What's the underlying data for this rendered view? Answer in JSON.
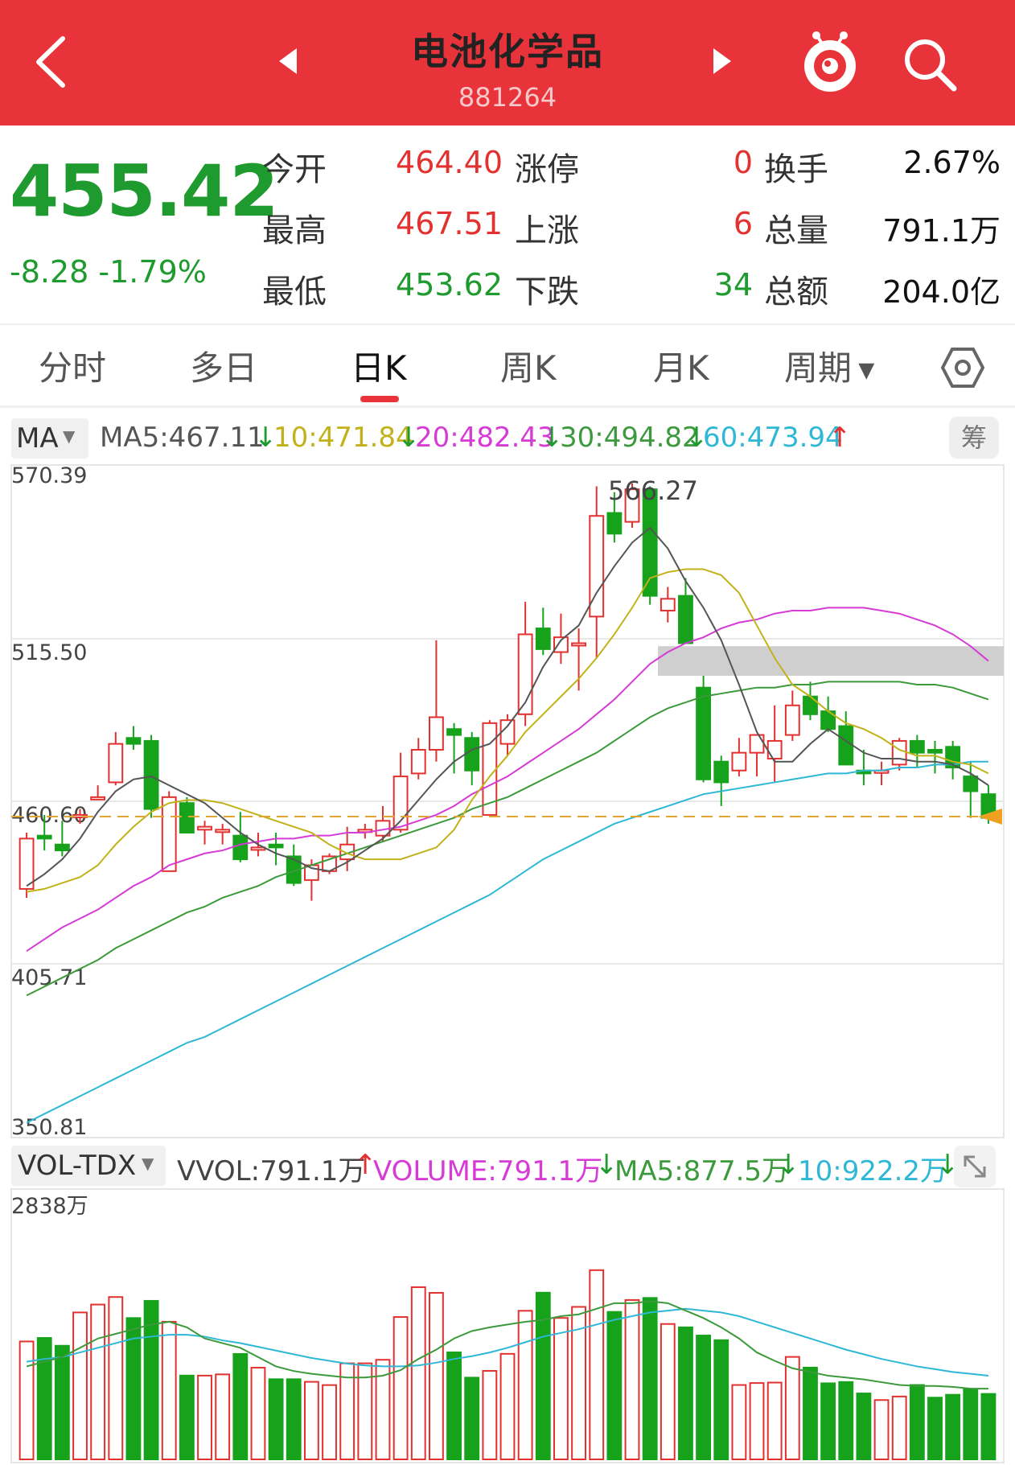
{
  "header": {
    "title": "电池化学品",
    "code": "881264"
  },
  "quote": {
    "price": "455.42",
    "change": "-8.28",
    "change_pct": "-1.79%",
    "open_label": "今开",
    "open": "464.40",
    "high_label": "最高",
    "high": "467.51",
    "low_label": "最低",
    "low": "453.62",
    "limit_up_label": "涨停",
    "limit_up": "0",
    "rise_label": "上涨",
    "rise": "6",
    "fall_label": "下跌",
    "fall": "34",
    "turnover_label": "换手",
    "turnover": "2.67%",
    "volume_label": "总量",
    "volume": "791.1万",
    "amount_label": "总额",
    "amount": "204.0亿"
  },
  "tabs": [
    "分时",
    "多日",
    "日K",
    "周K",
    "月K",
    "周期"
  ],
  "selected_tab": "日K",
  "ma_legend": {
    "selector": "MA",
    "ma5": "MA5:467.11",
    "ma10": "10:471.84",
    "ma20": "20:482.43",
    "ma30": "30:494.82",
    "ma60": "60:473.94",
    "chip_label": "筹"
  },
  "vol_legend": {
    "selector": "VOL-TDX",
    "vvol": "VVOL:791.1万",
    "volume": "VOLUME:791.1万",
    "ma5": "MA5:877.5万",
    "ma10": "10:922.2万"
  },
  "colors": {
    "up": "#e2312f",
    "down": "#16a21b",
    "ma5": "#555555",
    "ma10": "#c2b21a",
    "ma20": "#d63bd6",
    "ma30": "#3c9a3c",
    "ma60": "#2eb8d6"
  },
  "chart_data": [
    {
      "type": "candlestick",
      "y_ticks": [
        "570.39",
        "515.50",
        "460.60",
        "405.71",
        "350.81"
      ],
      "ylim": [
        350.81,
        570.39
      ],
      "high_marker": "566.27",
      "current_price_line": 455.42,
      "candles": [
        {
          "o": 431,
          "h": 450,
          "l": 428,
          "c": 448
        },
        {
          "o": 449,
          "h": 456,
          "l": 444,
          "c": 448
        },
        {
          "o": 446,
          "h": 454,
          "l": 442,
          "c": 444
        },
        {
          "o": 456,
          "h": 458,
          "l": 453,
          "c": 456
        },
        {
          "o": 462,
          "h": 466,
          "l": 461,
          "c": 462
        },
        {
          "o": 467,
          "h": 484,
          "l": 466,
          "c": 480
        },
        {
          "o": 482,
          "h": 486,
          "l": 478,
          "c": 480
        },
        {
          "o": 481,
          "h": 483,
          "l": 455,
          "c": 458
        },
        {
          "o": 437,
          "h": 464,
          "l": 437,
          "c": 462
        },
        {
          "o": 460,
          "h": 462,
          "l": 450,
          "c": 450
        },
        {
          "o": 451,
          "h": 454,
          "l": 446,
          "c": 452
        },
        {
          "o": 451,
          "h": 453,
          "l": 446,
          "c": 451
        },
        {
          "o": 449,
          "h": 457,
          "l": 440,
          "c": 441
        },
        {
          "o": 445,
          "h": 450,
          "l": 442,
          "c": 445
        },
        {
          "o": 446,
          "h": 450,
          "l": 439,
          "c": 445
        },
        {
          "o": 442,
          "h": 446,
          "l": 432,
          "c": 433
        },
        {
          "o": 434,
          "h": 441,
          "l": 427,
          "c": 439
        },
        {
          "o": 437,
          "h": 443,
          "l": 436,
          "c": 442
        },
        {
          "o": 441,
          "h": 452,
          "l": 437,
          "c": 446
        },
        {
          "o": 451,
          "h": 453,
          "l": 448,
          "c": 451
        },
        {
          "o": 449,
          "h": 459,
          "l": 447,
          "c": 454
        },
        {
          "o": 451,
          "h": 477,
          "l": 450,
          "c": 469
        },
        {
          "o": 470,
          "h": 482,
          "l": 468,
          "c": 478
        },
        {
          "o": 478,
          "h": 515,
          "l": 474,
          "c": 489
        },
        {
          "o": 485,
          "h": 487,
          "l": 470,
          "c": 483
        },
        {
          "o": 482,
          "h": 484,
          "l": 466,
          "c": 471
        },
        {
          "o": 456,
          "h": 488,
          "l": 456,
          "c": 487
        },
        {
          "o": 480,
          "h": 490,
          "l": 476,
          "c": 488
        },
        {
          "o": 490,
          "h": 528,
          "l": 486,
          "c": 517
        },
        {
          "o": 519,
          "h": 526,
          "l": 510,
          "c": 512
        },
        {
          "o": 511,
          "h": 524,
          "l": 507,
          "c": 516
        },
        {
          "o": 514,
          "h": 519,
          "l": 498,
          "c": 514
        },
        {
          "o": 523,
          "h": 567,
          "l": 509,
          "c": 557
        },
        {
          "o": 558,
          "h": 565,
          "l": 548,
          "c": 551
        },
        {
          "o": 555,
          "h": 568,
          "l": 553,
          "c": 566
        },
        {
          "o": 566,
          "h": 567,
          "l": 527,
          "c": 530
        },
        {
          "o": 525,
          "h": 533,
          "l": 521,
          "c": 529
        },
        {
          "o": 530,
          "h": 536,
          "l": 514,
          "c": 514
        },
        {
          "o": 499,
          "h": 503,
          "l": 467,
          "c": 468
        },
        {
          "o": 474,
          "h": 476,
          "l": 459,
          "c": 467
        },
        {
          "o": 471,
          "h": 482,
          "l": 469,
          "c": 477
        },
        {
          "o": 477,
          "h": 482,
          "l": 469,
          "c": 483
        },
        {
          "o": 475,
          "h": 493,
          "l": 467,
          "c": 481
        },
        {
          "o": 483,
          "h": 498,
          "l": 481,
          "c": 493
        },
        {
          "o": 496,
          "h": 501,
          "l": 488,
          "c": 490
        },
        {
          "o": 491,
          "h": 496,
          "l": 484,
          "c": 485
        },
        {
          "o": 486,
          "h": 491,
          "l": 483,
          "c": 473
        },
        {
          "o": 471,
          "h": 478,
          "l": 466,
          "c": 470
        },
        {
          "o": 471,
          "h": 474,
          "l": 466,
          "c": 471
        },
        {
          "o": 473,
          "h": 482,
          "l": 471,
          "c": 481
        },
        {
          "o": 481,
          "h": 483,
          "l": 472,
          "c": 477
        },
        {
          "o": 478,
          "h": 481,
          "l": 470,
          "c": 477
        },
        {
          "o": 479,
          "h": 481,
          "l": 468,
          "c": 472
        },
        {
          "o": 469,
          "h": 474,
          "l": 455,
          "c": 464
        },
        {
          "o": 463,
          "h": 466,
          "l": 453,
          "c": 455
        }
      ],
      "ma5": [
        432,
        436,
        441,
        448,
        457,
        464,
        468,
        469,
        466,
        463,
        460,
        455,
        450,
        446,
        443,
        441,
        438,
        437,
        440,
        444,
        448,
        454,
        461,
        468,
        474,
        478,
        480,
        486,
        494,
        506,
        515,
        520,
        531,
        540,
        548,
        553,
        546,
        535,
        526,
        515,
        500,
        484,
        474,
        474,
        480,
        485,
        481,
        477,
        475,
        475,
        474,
        474,
        473,
        470,
        466
      ],
      "ma10": [
        430,
        431,
        433,
        435,
        439,
        446,
        452,
        457,
        460,
        461,
        461,
        460,
        458,
        456,
        454,
        452,
        450,
        446,
        443,
        441,
        441,
        441,
        443,
        445,
        451,
        461,
        469,
        476,
        484,
        490,
        496,
        502,
        509,
        517,
        526,
        536,
        538,
        539,
        539,
        537,
        531,
        520,
        509,
        500,
        496,
        491,
        487,
        485,
        482,
        478,
        476,
        476,
        474,
        473,
        470
      ],
      "ma20": [
        410,
        414,
        418,
        421,
        424,
        428,
        432,
        435,
        439,
        441,
        443,
        444,
        446,
        447,
        448,
        448,
        449,
        449,
        450,
        450,
        451,
        452,
        454,
        456,
        459,
        463,
        466,
        469,
        473,
        477,
        481,
        485,
        490,
        495,
        501,
        507,
        511,
        514,
        516,
        519,
        521,
        522,
        524,
        525,
        525,
        526,
        526,
        526,
        525,
        524,
        522,
        520,
        517,
        513,
        508
      ],
      "ma30": [
        395,
        398,
        401,
        404,
        407,
        411,
        414,
        417,
        420,
        423,
        425,
        428,
        430,
        432,
        435,
        437,
        439,
        441,
        443,
        445,
        447,
        449,
        451,
        453,
        455,
        458,
        460,
        462,
        465,
        468,
        471,
        474,
        477,
        481,
        485,
        489,
        492,
        494,
        496,
        497,
        498,
        499,
        499,
        500,
        500,
        501,
        501,
        501,
        501,
        501,
        500,
        500,
        499,
        497,
        495
      ],
      "ma60": [
        352,
        355,
        358,
        361,
        364,
        367,
        370,
        373,
        376,
        379,
        381,
        384,
        387,
        390,
        393,
        396,
        399,
        402,
        405,
        408,
        411,
        414,
        417,
        420,
        423,
        426,
        429,
        433,
        437,
        441,
        444,
        447,
        450,
        453,
        455,
        457,
        459,
        461,
        463,
        464,
        465,
        466,
        467,
        468,
        469,
        470,
        470,
        471,
        471,
        472,
        472,
        473,
        473,
        474,
        474
      ]
    },
    {
      "type": "bar",
      "series_name": "VOLUME",
      "y_ticks": [
        "2838万"
      ],
      "ylim": [
        0,
        2838
      ],
      "volumes": [
        1268,
        1306,
        1222,
        1580,
        1665,
        1746,
        1520,
        1705,
        1480,
        901,
        901,
        914,
        1134,
        986,
        862,
        862,
        834,
        799,
        1033,
        1033,
        1071,
        1531,
        1852,
        1791,
        1151,
        879,
        952,
        1135,
        1598,
        1793,
        1521,
        1640,
        2035,
        1586,
        1714,
        1736,
        1456,
        1420,
        1332,
        1282,
        800,
        821,
        826,
        1102,
        987,
        818,
        832,
        709,
        638,
        676,
        800,
        664,
        695,
        758,
        704
      ],
      "vol_ma5": [
        1000,
        1050,
        1100,
        1200,
        1300,
        1350,
        1400,
        1450,
        1480,
        1420,
        1300,
        1250,
        1200,
        1100,
        1000,
        950,
        920,
        900,
        880,
        880,
        900,
        960,
        1080,
        1180,
        1300,
        1380,
        1420,
        1450,
        1480,
        1500,
        1540,
        1560,
        1620,
        1680,
        1680,
        1700,
        1680,
        1600,
        1520,
        1420,
        1300,
        1150,
        1060,
        980,
        940,
        900,
        880,
        860,
        830,
        800,
        790,
        790,
        780,
        760,
        760
      ],
      "vol_ma10": [
        1050,
        1080,
        1100,
        1150,
        1200,
        1250,
        1300,
        1320,
        1340,
        1340,
        1320,
        1280,
        1250,
        1210,
        1170,
        1130,
        1090,
        1060,
        1030,
        1010,
        1000,
        1000,
        1010,
        1040,
        1080,
        1110,
        1150,
        1200,
        1260,
        1320,
        1360,
        1400,
        1450,
        1500,
        1540,
        1580,
        1600,
        1620,
        1600,
        1580,
        1540,
        1480,
        1420,
        1360,
        1300,
        1240,
        1180,
        1130,
        1080,
        1040,
        1000,
        970,
        940,
        920,
        900
      ]
    }
  ]
}
